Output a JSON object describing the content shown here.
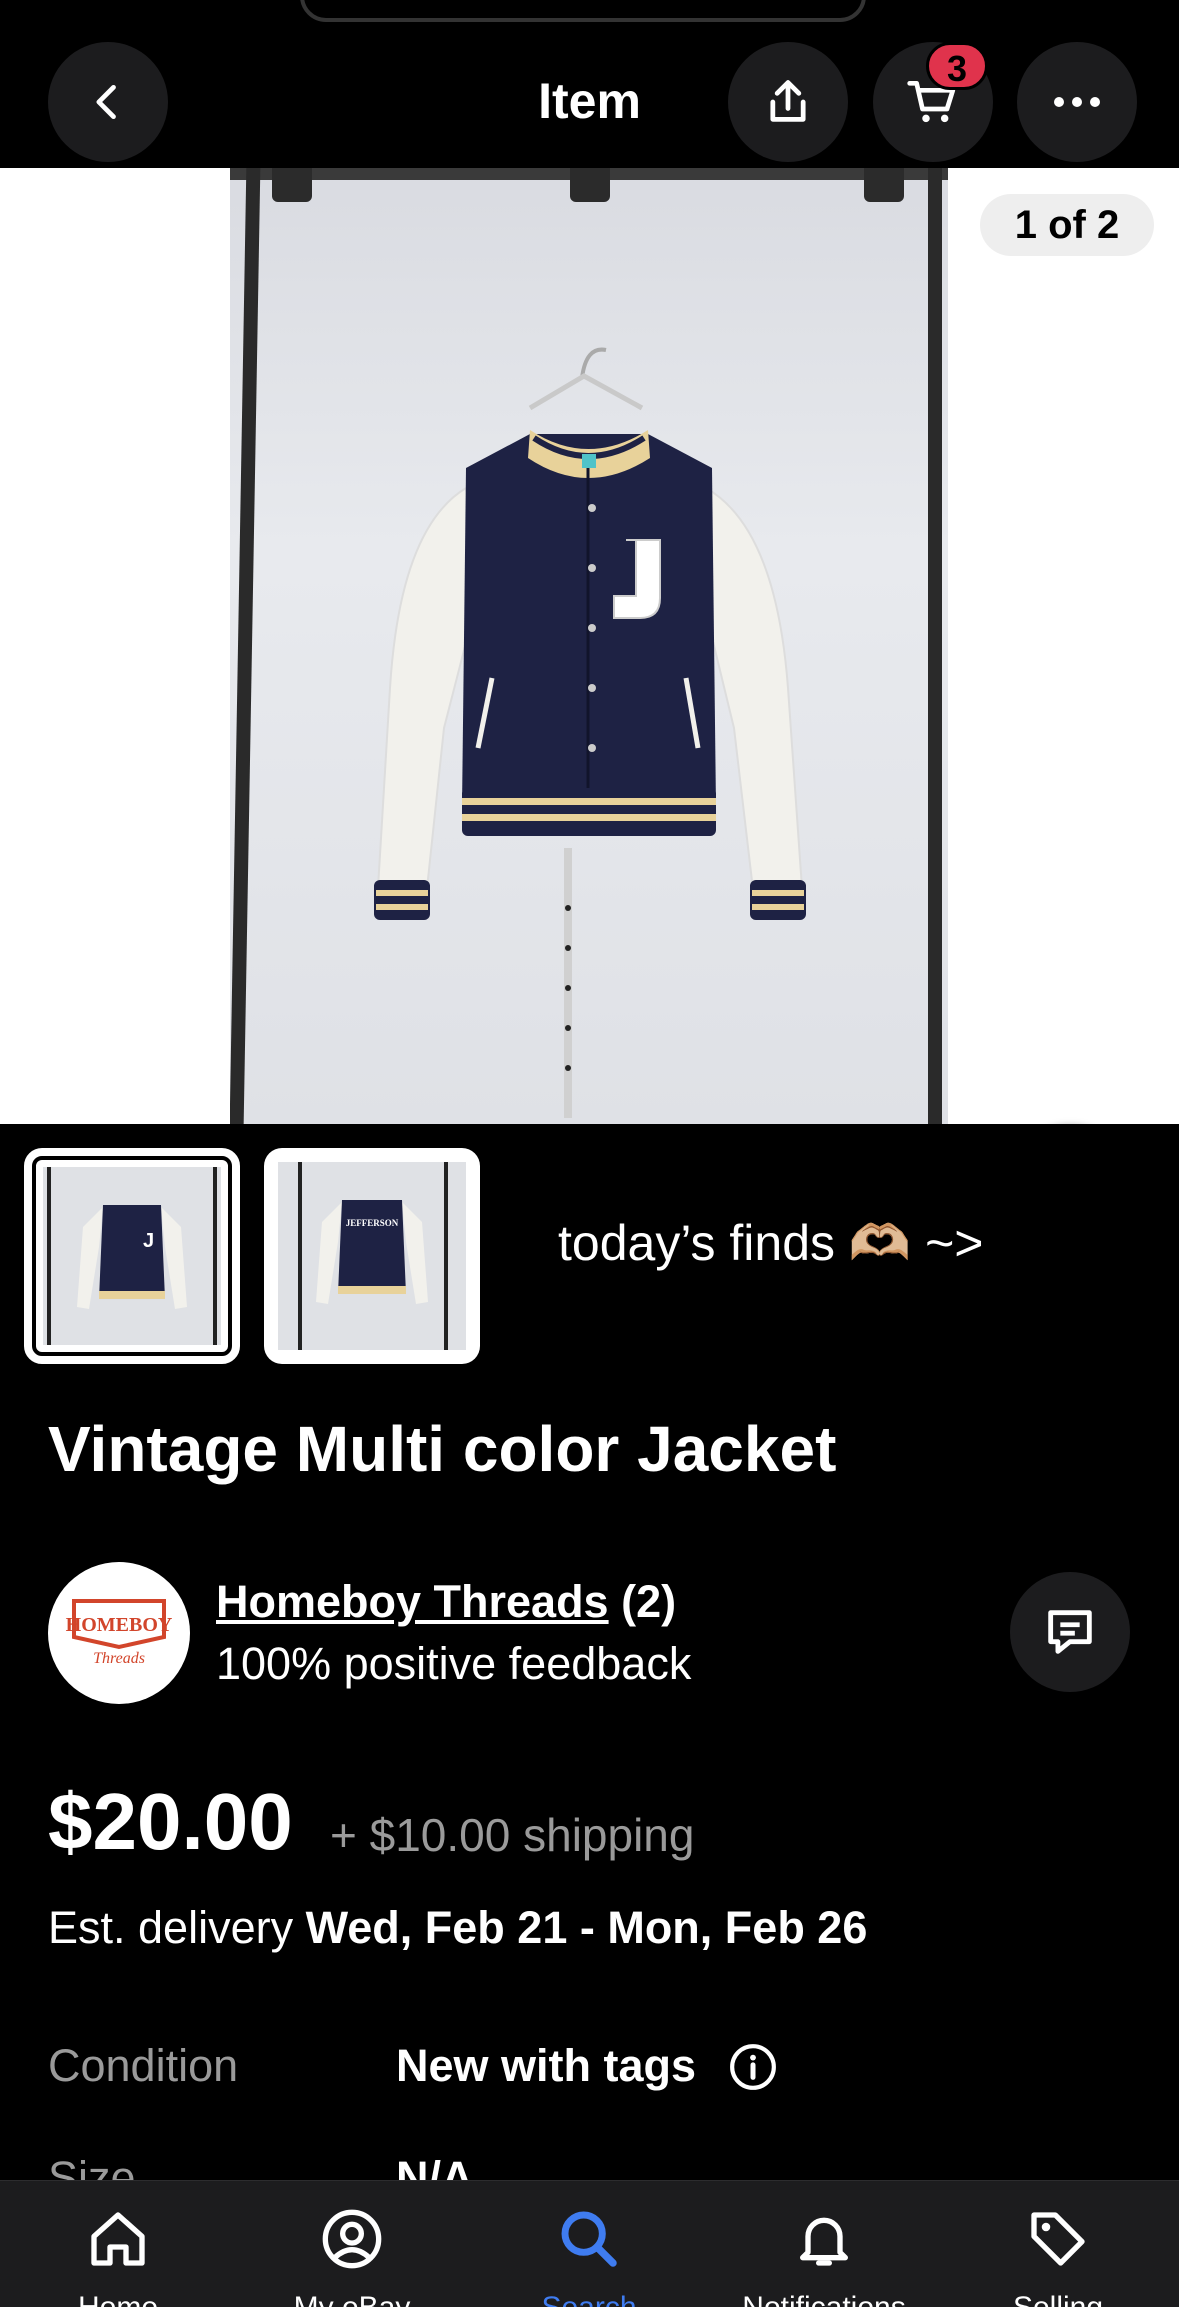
{
  "header": {
    "title": "Item",
    "back_icon": "chevron-left-icon",
    "share_icon": "share-icon",
    "cart_icon": "cart-icon",
    "cart_count": "3",
    "more_icon": "more-horizontal-icon"
  },
  "gallery": {
    "counter": "1 of 2",
    "favorite_icon": "heart-icon",
    "thumbnails": [
      {
        "letter": "J",
        "selected": true
      },
      {
        "letter": "JEFFERSON",
        "selected": false
      }
    ],
    "finds_text": "today’s finds 🫶🏼 ~>"
  },
  "item": {
    "title": "Vintage Multi color Jacket"
  },
  "seller": {
    "logo_text_top": "HOMEBOY",
    "logo_text_bottom": "Threads",
    "name": "Homeboy Threads",
    "count": "(2)",
    "feedback": "100% positive feedback",
    "message_icon": "message-icon"
  },
  "pricing": {
    "price": "$20.00",
    "shipping": "+ $10.00 shipping",
    "delivery_prefix": "Est. delivery",
    "delivery_dates": "Wed, Feb 21 - Mon, Feb 26"
  },
  "specifics": [
    {
      "label": "Condition",
      "value": "New with tags"
    },
    {
      "label": "Size",
      "value": "N/A"
    }
  ],
  "bottom_nav": [
    {
      "label": "Home",
      "icon": "home-icon",
      "active": false
    },
    {
      "label": "My eBay",
      "icon": "profile-icon",
      "active": false
    },
    {
      "label": "Search",
      "icon": "search-icon",
      "active": true
    },
    {
      "label": "Notifications",
      "icon": "bell-icon",
      "active": false
    },
    {
      "label": "Selling",
      "icon": "tag-icon",
      "active": false
    }
  ],
  "colors": {
    "accent": "#3f7cf0",
    "badge": "#e0334c",
    "jacket_body": "#1e2244",
    "jacket_trim": "#e8d29a"
  }
}
